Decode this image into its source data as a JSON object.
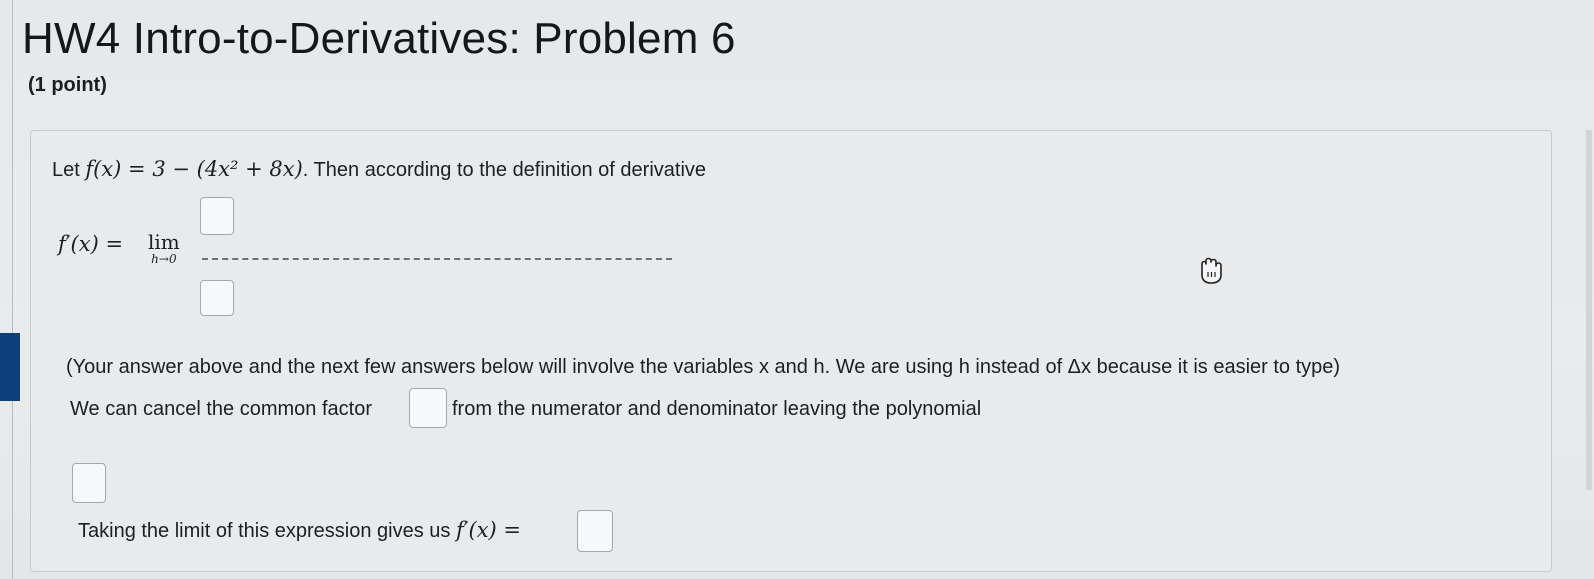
{
  "page": {
    "title": "HW4 Intro-to-Derivatives: Problem 6",
    "points": "(1 point)"
  },
  "problem": {
    "intro_prefix": "Let",
    "function_def": "f(x) = 3 − (4x² + 8x)",
    "intro_suffix": ". Then according to the definition of derivative",
    "derivative_lhs": "f′(x) =",
    "lim_word": "lim",
    "lim_sub": "h→0",
    "note": "(Your answer above and the next few answers below will involve the variables x and h. We are using h instead of Δx because it is easier to type)",
    "cancel_prefix": "We can cancel the common factor",
    "cancel_suffix": "from the numerator and denominator leaving the polynomial",
    "taking_limit_text": "Taking the limit of this expression gives us",
    "final_lhs": "f′(x) ="
  },
  "inputs": {
    "numerator": "",
    "denominator": "",
    "common_factor": "",
    "polynomial": "",
    "final_answer": ""
  },
  "icons": {
    "cursor": "hand-cursor-icon"
  },
  "colors": {
    "selection_marker": "#0f3e7d",
    "panel_bg": "#e8eaec",
    "box_border": "#a2a8ae"
  }
}
